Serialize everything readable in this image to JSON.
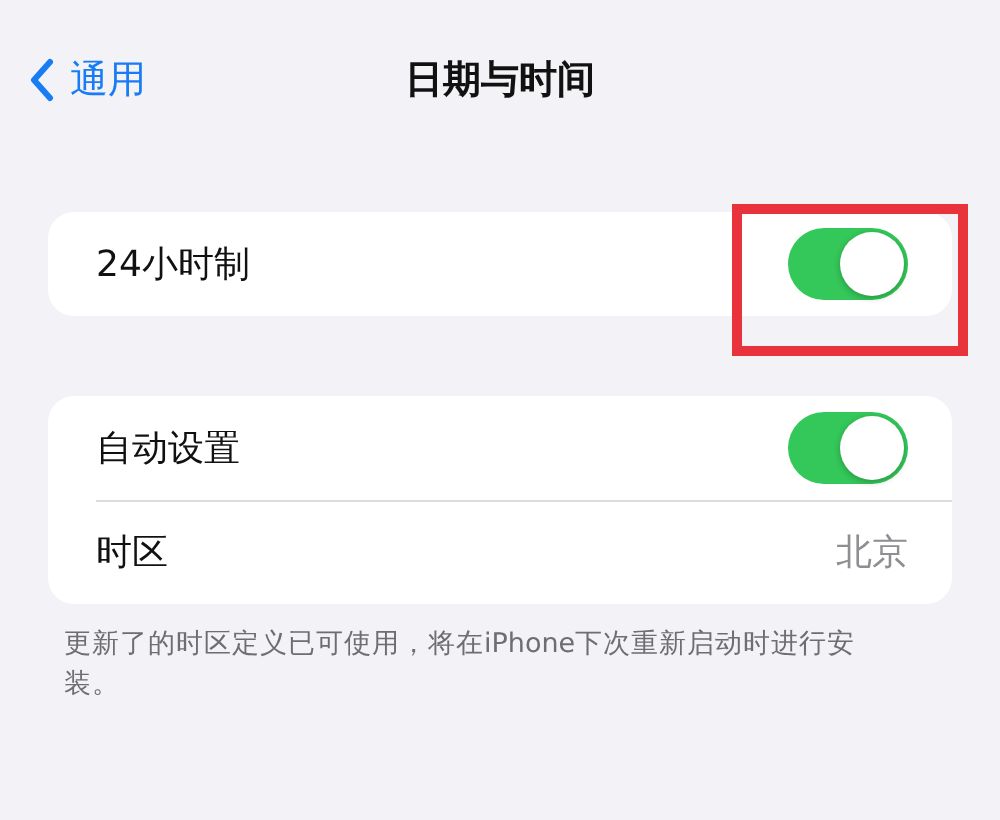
{
  "nav_bar": {
    "back_label": "通用",
    "title": "日期与时间"
  },
  "groups": [
    {
      "rows": [
        {
          "kind": "toggle",
          "label": "24小时制",
          "on": true,
          "highlighted": true
        }
      ]
    },
    {
      "rows": [
        {
          "kind": "toggle",
          "label": "自动设置",
          "on": true,
          "highlighted": false
        },
        {
          "kind": "value",
          "label": "时区",
          "value": "北京"
        }
      ]
    }
  ],
  "footer": "更新了的时区定义已可使用，将在iPhone下次重新启动时进行安装。"
}
